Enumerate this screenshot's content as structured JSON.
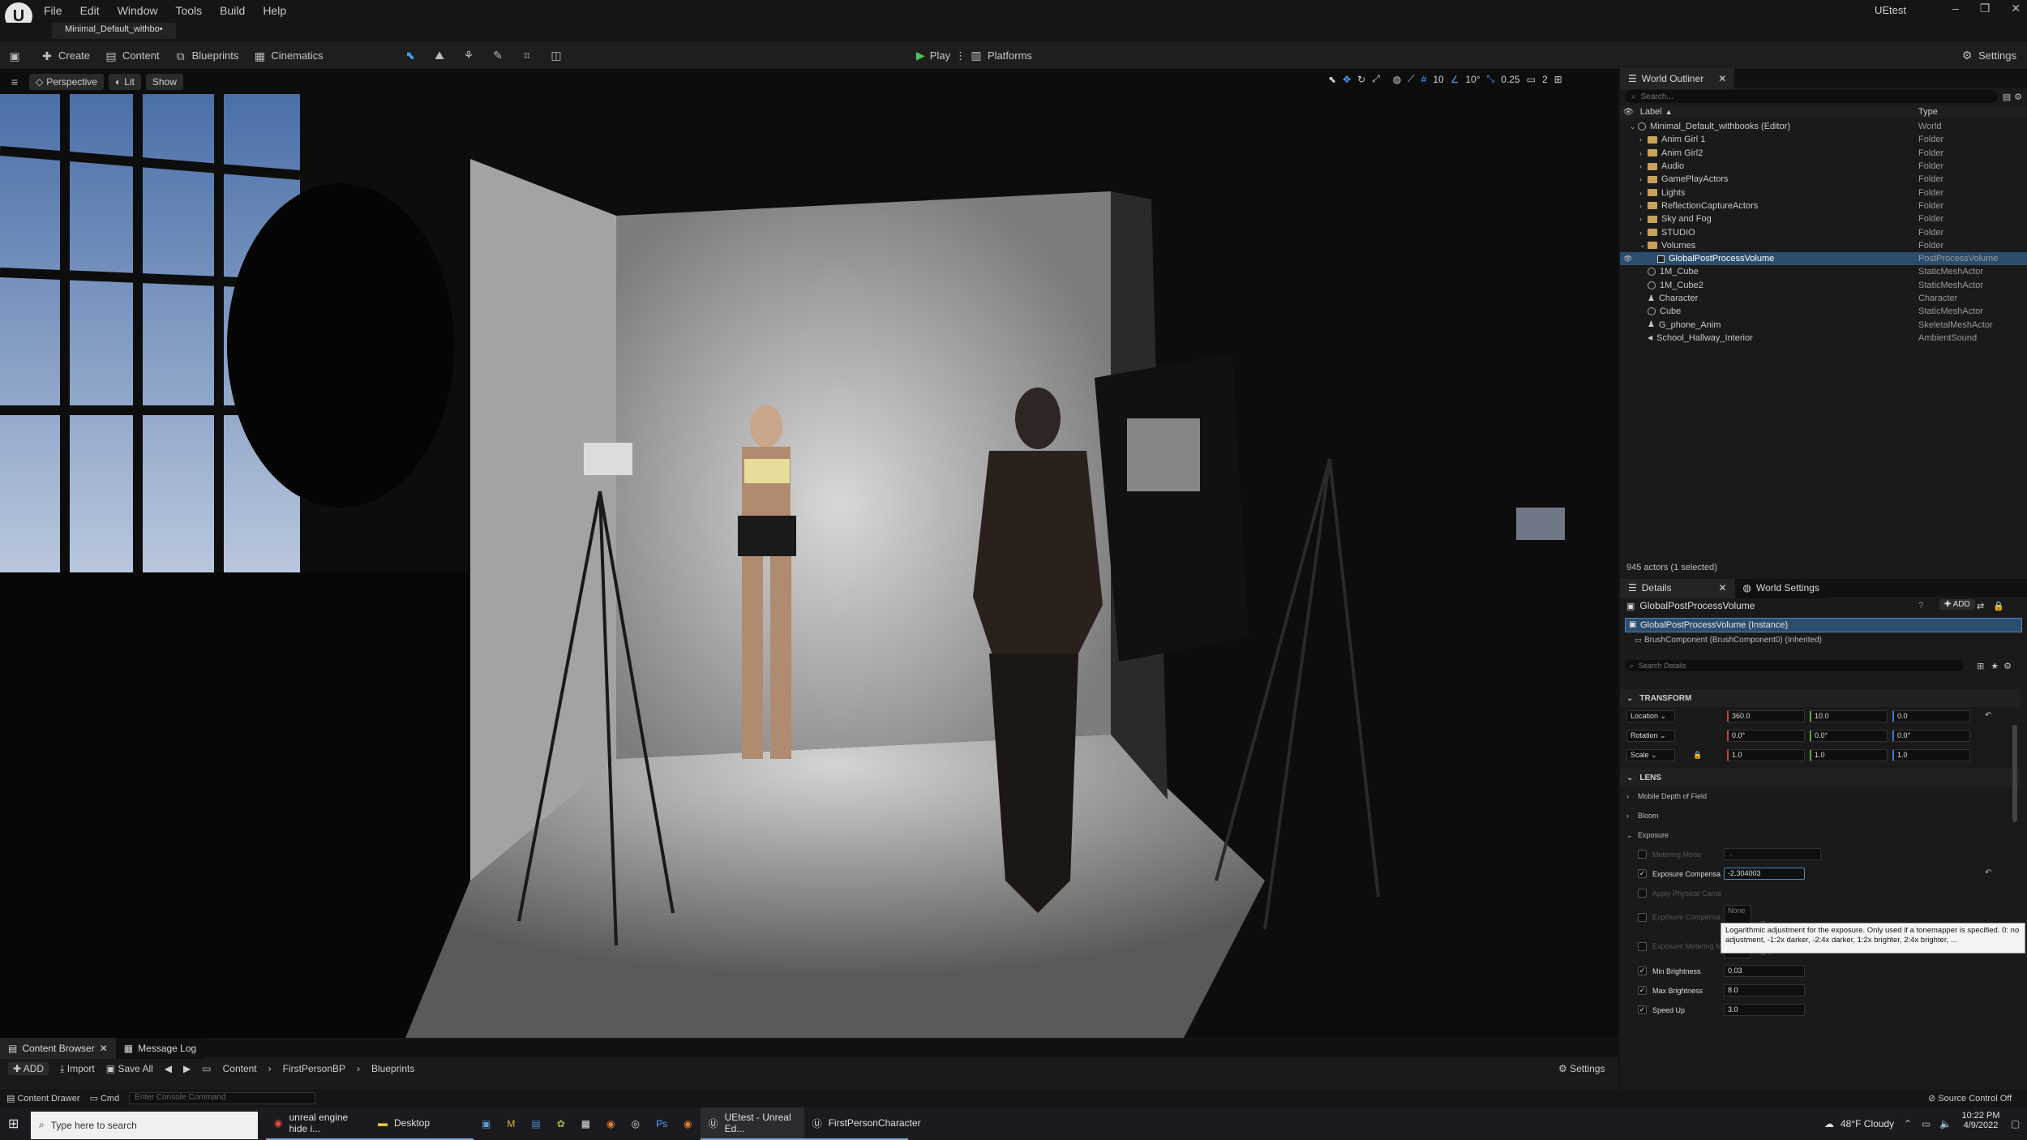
{
  "menu": [
    "File",
    "Edit",
    "Window",
    "Tools",
    "Build",
    "Help"
  ],
  "project_name": "UEtest",
  "level_tab": "Minimal_Default_withbo•",
  "toolbar": {
    "create": "Create",
    "content": "Content",
    "blueprints": "Blueprints",
    "cinematics": "Cinematics",
    "play": "Play",
    "platforms": "Platforms",
    "settings": "Settings"
  },
  "viewport": {
    "perspective": "Perspective",
    "lit": "Lit",
    "show": "Show",
    "grid": "10",
    "angle": "10°",
    "scale": "0.25",
    "cams": "2"
  },
  "outliner": {
    "tab": "World Outliner",
    "search": "Search...",
    "col_label": "Label",
    "col_type": "Type",
    "items": [
      {
        "label": "Minimal_Default_withbooks (Editor)",
        "type": "World",
        "indent": 1,
        "kind": "world"
      },
      {
        "label": "Anim Girl 1",
        "type": "Folder",
        "indent": 2,
        "kind": "folder"
      },
      {
        "label": "Anim Girl2",
        "type": "Folder",
        "indent": 2,
        "kind": "folder"
      },
      {
        "label": "Audio",
        "type": "Folder",
        "indent": 2,
        "kind": "folder"
      },
      {
        "label": "GamePlayActors",
        "type": "Folder",
        "indent": 2,
        "kind": "folder"
      },
      {
        "label": "Lights",
        "type": "Folder",
        "indent": 2,
        "kind": "folder"
      },
      {
        "label": "ReflectionCaptureActors",
        "type": "Folder",
        "indent": 2,
        "kind": "folder"
      },
      {
        "label": "Sky and Fog",
        "type": "Folder",
        "indent": 2,
        "kind": "folder"
      },
      {
        "label": "STUDIO",
        "type": "Folder",
        "indent": 2,
        "kind": "folder"
      },
      {
        "label": "Volumes",
        "type": "Folder",
        "indent": 2,
        "kind": "folder"
      },
      {
        "label": "GlobalPostProcessVolume",
        "type": "PostProcessVolume",
        "indent": 3,
        "kind": "volume",
        "selected": true
      },
      {
        "label": "1M_Cube",
        "type": "StaticMeshActor",
        "indent": 2,
        "kind": "mesh"
      },
      {
        "label": "1M_Cube2",
        "type": "StaticMeshActor",
        "indent": 2,
        "kind": "mesh"
      },
      {
        "label": "Character",
        "type": "Character",
        "indent": 2,
        "kind": "char"
      },
      {
        "label": "Cube",
        "type": "StaticMeshActor",
        "indent": 2,
        "kind": "mesh"
      },
      {
        "label": "G_phone_Anim",
        "type": "SkeletalMeshActor",
        "indent": 2,
        "kind": "char"
      },
      {
        "label": "School_Hallway_Interior",
        "type": "AmbientSound",
        "indent": 2,
        "kind": "sound"
      }
    ],
    "footer": "945 actors (1 selected)"
  },
  "details": {
    "tab": "Details",
    "tab2": "World Settings",
    "actor": "GlobalPostProcessVolume",
    "add": "ADD",
    "instance": "GlobalPostProcessVolume (Instance)",
    "component": "BrushComponent (BrushComponent0) (Inherited)",
    "search": "Search Details",
    "transform_header": "TRANSFORM",
    "location_label": "Location",
    "rotation_label": "Rotation",
    "scale_label": "Scale",
    "location": [
      "360.0",
      "10.0",
      "0.0"
    ],
    "rotation": [
      "0.0°",
      "0.0°",
      "0.0°"
    ],
    "scale": [
      "1.0",
      "1.0",
      "1.0"
    ],
    "lens_header": "LENS",
    "mobile_dof": "Mobile Depth of Field",
    "bloom": "Bloom",
    "exposure": "Exposure",
    "metering_mode": "Metering Mode",
    "exposure_comp": "Exposure Compensa",
    "exposure_value": "-2.304003",
    "apply_physical": "Apply Physical Came",
    "exposure_comp_curve": "Exposure Compensa",
    "exposure_metering": "Exposure Metering M",
    "none": "None",
    "tooltip": "Logarithmic adjustment for the exposure. Only used if a tonemapper is specified. 0: no adjustment, -1:2x darker, -2:4x darker, 1:2x brighter, 2:4x brighter, ...",
    "min_brightness": "Min Brightness",
    "min_value": "0.03",
    "max_brightness": "Max Brightness",
    "max_value": "8.0",
    "speed_up": "Speed Up",
    "speed_value": "3.0"
  },
  "bottom": {
    "content_browser": "Content Browser",
    "message_log": "Message Log",
    "add": "ADD",
    "import": "Import",
    "save_all": "Save All",
    "path": [
      "Content",
      "FirstPersonBP",
      "Blueprints"
    ],
    "settings": "Settings"
  },
  "status": {
    "content_drawer": "Content Drawer",
    "cmd": "Cmd",
    "console_placeholder": "Enter Console Command",
    "source_control": "Source Control Off"
  },
  "taskbar": {
    "search": "Type here to search",
    "chrome": "unreal engine hide i...",
    "desktop": "Desktop",
    "ue": "UEtest - Unreal Ed...",
    "fpc": "FirstPersonCharacter",
    "weather": "48°F Cloudy",
    "time": "10:22 PM",
    "date": "4/9/2022"
  }
}
